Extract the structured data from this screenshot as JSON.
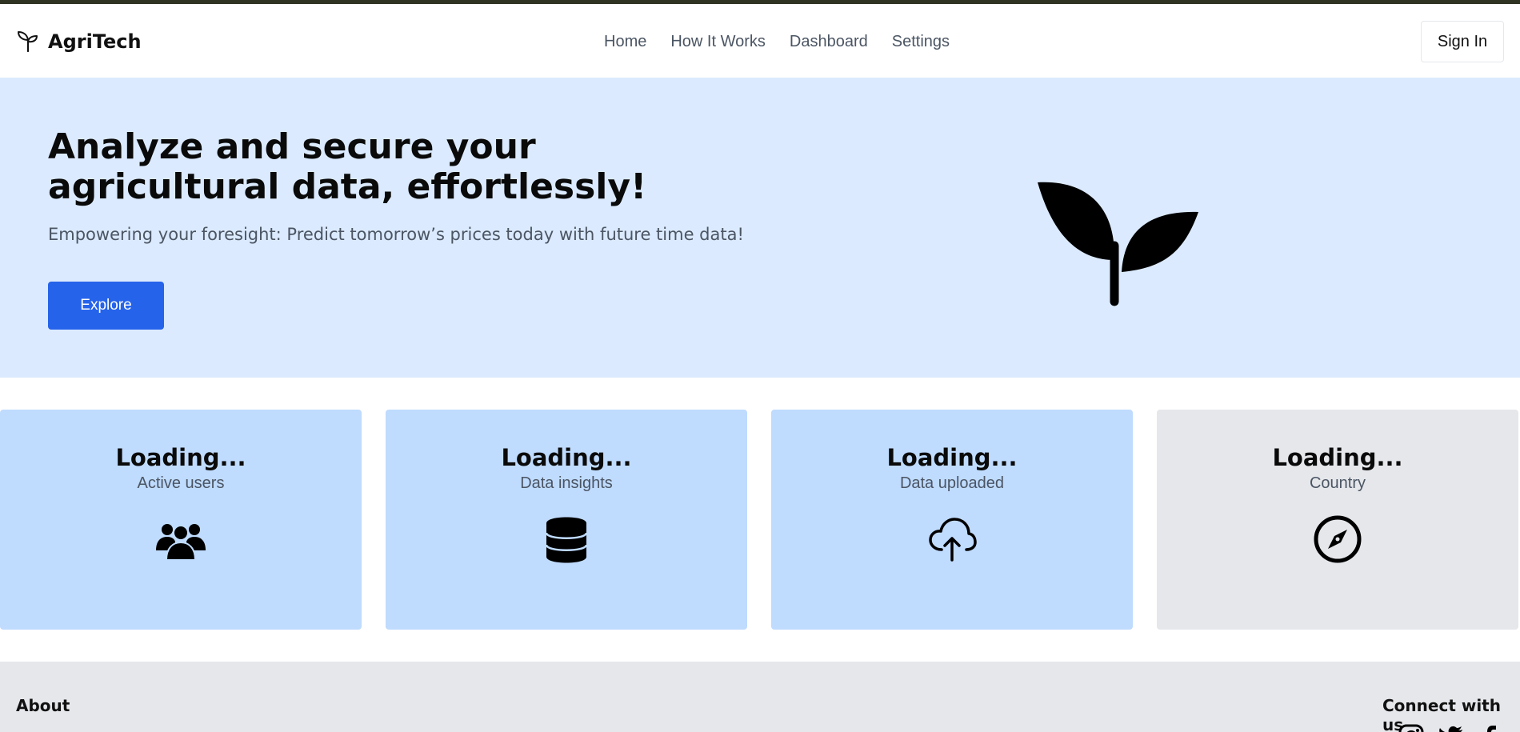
{
  "brand": {
    "name": "AgriTech",
    "icon": "sprout-icon"
  },
  "nav": {
    "items": [
      {
        "label": "Home"
      },
      {
        "label": "How It Works"
      },
      {
        "label": "Dashboard"
      },
      {
        "label": "Settings"
      }
    ],
    "signin_label": "Sign In"
  },
  "hero": {
    "title": "Analyze and secure your agricultural data, effortlessly!",
    "subtitle": "Empowering your foresight: Predict tomorrow’s prices today with future time data!",
    "cta_label": "Explore",
    "illustration": "sprout-icon"
  },
  "stats": [
    {
      "value": "Loading...",
      "label": "Active users",
      "icon": "users-icon",
      "bg": "#bfdbfe"
    },
    {
      "value": "Loading...",
      "label": "Data insights",
      "icon": "database-icon",
      "bg": "#bfdbfe"
    },
    {
      "value": "Loading...",
      "label": "Data uploaded",
      "icon": "cloud-upload-icon",
      "bg": "#bfdbfe"
    },
    {
      "value": "Loading...",
      "label": "Country",
      "icon": "compass-icon",
      "bg": "#e5e7eb"
    }
  ],
  "footer": {
    "about_label": "About",
    "connect_label": "Connect with us",
    "social_icons": [
      "instagram-icon",
      "twitter-icon",
      "facebook-icon"
    ]
  },
  "colors": {
    "accent": "#2563eb",
    "hero_bg": "#dbeafe",
    "card_blue": "#bfdbfe",
    "card_gray": "#e5e7eb",
    "top_strip": "#2f3322"
  }
}
